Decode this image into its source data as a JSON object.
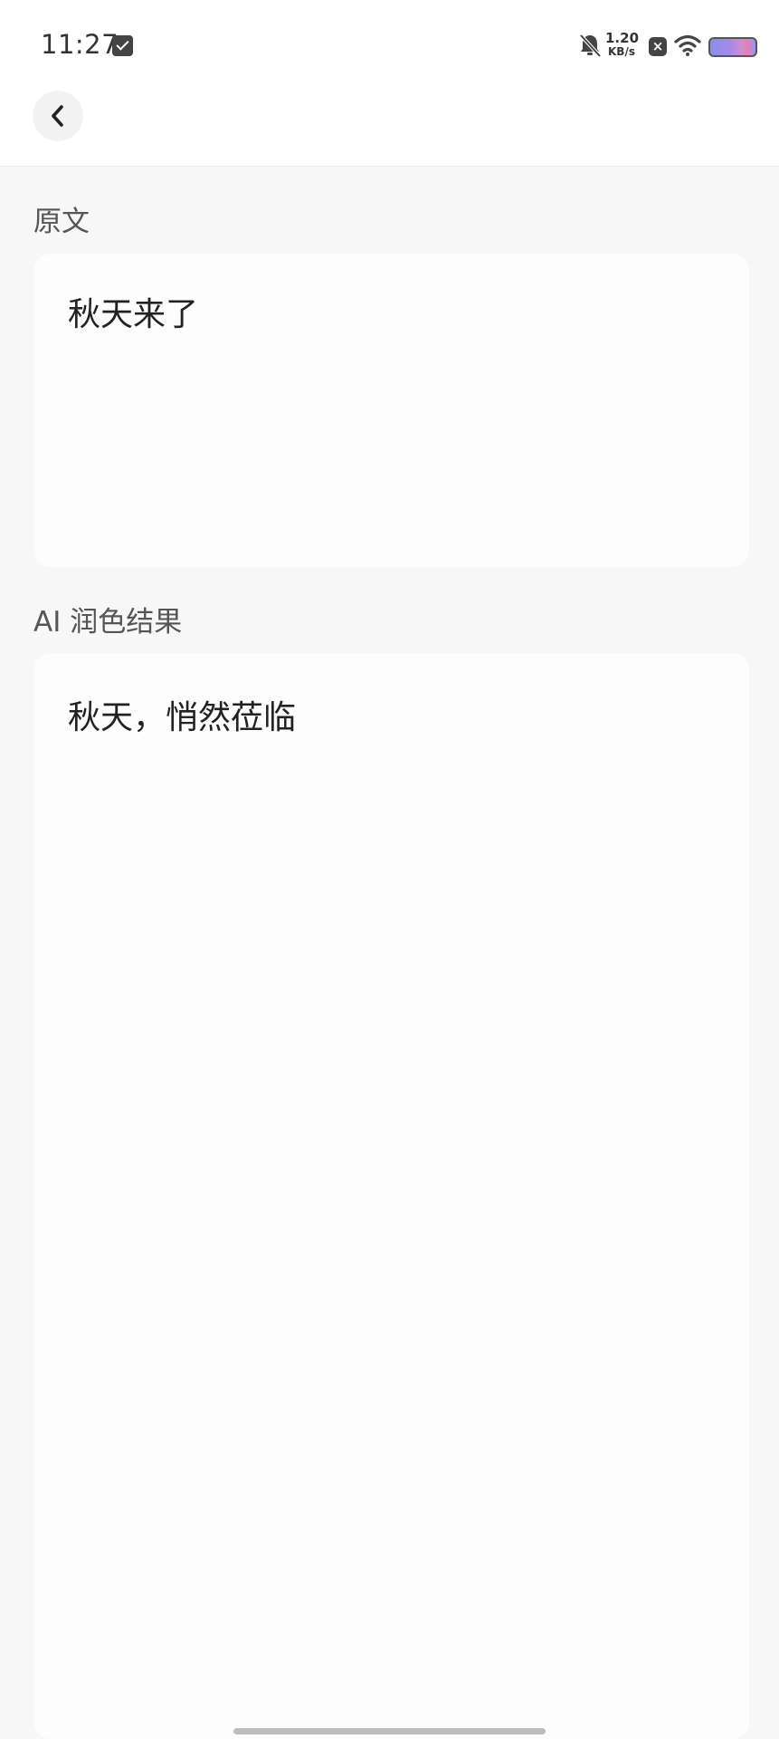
{
  "status_bar": {
    "time": "11:27",
    "speed_value": "1.20",
    "speed_unit": "KB/s",
    "icons": [
      "mail-icon",
      "bell-off-icon",
      "close-box-icon",
      "wifi-icon",
      "battery-icon"
    ]
  },
  "nav": {
    "back_icon": "chevron-left-icon"
  },
  "original": {
    "label": "原文",
    "text": "秋天来了"
  },
  "result": {
    "label": "AI 润色结果",
    "text": "秋天，悄然莅临"
  }
}
